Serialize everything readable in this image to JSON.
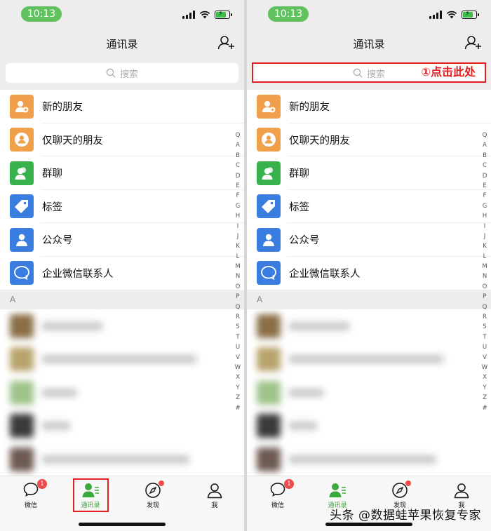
{
  "status": {
    "time": "10:13"
  },
  "header": {
    "title": "通讯录"
  },
  "search": {
    "placeholder": "搜索"
  },
  "annotation": {
    "text": "①点击此处"
  },
  "menu": [
    {
      "label": "新的朋友",
      "icon": "add-friend-icon",
      "color": "#f0a04b"
    },
    {
      "label": "仅聊天的朋友",
      "icon": "chat-only-friend-icon",
      "color": "#f0a04b"
    },
    {
      "label": "群聊",
      "icon": "group-chat-icon",
      "color": "#37b24d"
    },
    {
      "label": "标签",
      "icon": "tag-icon",
      "color": "#3a7de0"
    },
    {
      "label": "公众号",
      "icon": "official-account-icon",
      "color": "#3a7de0"
    },
    {
      "label": "企业微信联系人",
      "icon": "work-wechat-icon",
      "color": "#3a7de0"
    }
  ],
  "section": {
    "letter": "A"
  },
  "index": [
    "Q",
    "A",
    "B",
    "C",
    "D",
    "E",
    "F",
    "G",
    "H",
    "I",
    "J",
    "K",
    "L",
    "M",
    "N",
    "O",
    "P",
    "Q",
    "R",
    "S",
    "T",
    "U",
    "V",
    "W",
    "X",
    "Y",
    "Z",
    "#"
  ],
  "tabs": [
    {
      "label": "微信",
      "badge": "1"
    },
    {
      "label": "通讯录"
    },
    {
      "label": "发现"
    },
    {
      "label": "我"
    }
  ],
  "watermark": "头条 @数据蛙苹果恢复专家",
  "colors": {
    "accent": "#07c160",
    "annotation": "#e02020"
  }
}
